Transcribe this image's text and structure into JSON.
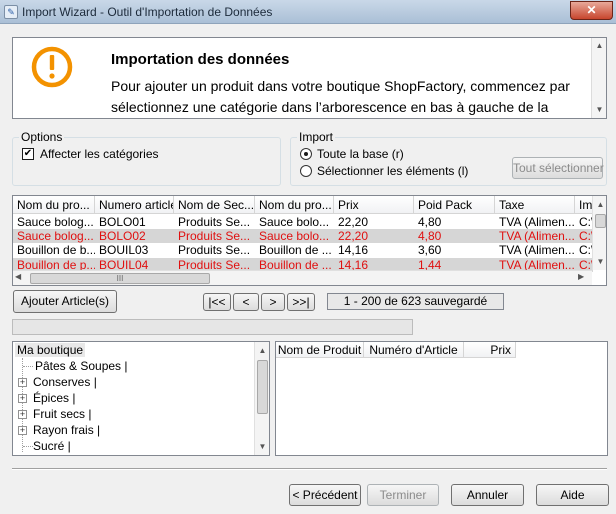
{
  "window": {
    "title": "Import Wizard - Outil d'Importation de Données",
    "close_label": "✕"
  },
  "header": {
    "title": "Importation des données",
    "text": "Pour ajouter un produit dans votre boutique ShopFactory, commencez par sélectionnez une catégorie dans l’arborescence en bas à gauche de la fenêtre. Pour utiliser la classification présente dans votre document"
  },
  "options": {
    "label": "Options",
    "assign_categories": {
      "label": "Affecter les catégories",
      "checked": true
    }
  },
  "import": {
    "label": "Import",
    "radio_all": {
      "label": "Toute la base (r)",
      "selected": true
    },
    "radio_selected": {
      "label": "Sélectionner les éléments (l)",
      "selected": false
    },
    "select_all_button": "Tout sélectionner"
  },
  "grid": {
    "columns": [
      "Nom du pro...",
      "Numero article",
      "Nom de Sec...",
      "Nom du pro...",
      "Prix",
      "Poid Pack",
      "Taxe",
      "Ima"
    ],
    "rows": [
      [
        "Sauce bolog...",
        "BOLO01",
        "Produits Se...",
        "Sauce bolo...",
        "22,20",
        "4,80",
        "TVA (Alimen...",
        "C:\\"
      ],
      [
        "Sauce bolog...",
        "BOLO02",
        "Produits Se...",
        "Sauce bolo...",
        "22,20",
        "4,80",
        "TVA (Alimen...",
        "C:\\"
      ],
      [
        "Bouillon de b...",
        "BOUIL03",
        "Produits Se...",
        "Bouillon de ...",
        "14,16",
        "3,60",
        "TVA (Alimen...",
        "C:\\"
      ],
      [
        "Bouillon de p...",
        "BOUIL04",
        "Produits Se...",
        "Bouillon de ...",
        "14,16",
        "1,44",
        "TVA (Alimen...",
        "C:\\"
      ]
    ],
    "row_colors": [
      "#000000",
      "#e01010",
      "#000000",
      "#e01010"
    ],
    "hscroll_grip": "III"
  },
  "nav": {
    "add_button": "Ajouter Article(s)",
    "first": "|<<",
    "prev": "<",
    "next": ">",
    "last": ">>|",
    "status": "1 - 200 de 623 sauvegardé"
  },
  "tree": {
    "root": "Ma boutique",
    "items": [
      {
        "label": "Pâtes & Soupes |",
        "expandable": false
      },
      {
        "label": "Conserves |",
        "expandable": true
      },
      {
        "label": "Épices |",
        "expandable": true
      },
      {
        "label": "Fruit secs |",
        "expandable": true
      },
      {
        "label": "Rayon frais |",
        "expandable": true
      },
      {
        "label": "Sucré |",
        "expandable": false
      }
    ]
  },
  "product_list": {
    "columns": [
      "Nom de Produit",
      "Numéro d'Article",
      "Prix"
    ]
  },
  "footer": {
    "previous": "< Précédent",
    "finish": "Terminer",
    "cancel": "Annuler",
    "help": "Aide"
  },
  "colors": {
    "warning": "#f39200",
    "highlight_red": "#e01010",
    "selected_row": "#d6d6d6"
  }
}
